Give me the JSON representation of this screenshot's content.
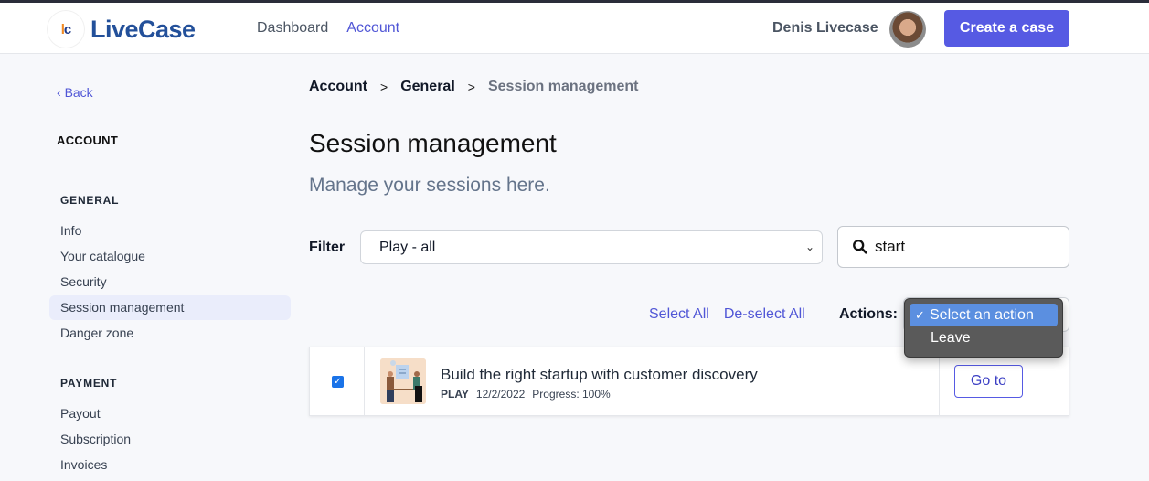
{
  "header": {
    "logo_text": "LiveCase",
    "logo_badge_l": "l",
    "logo_badge_c": "c",
    "nav": [
      {
        "label": "Dashboard",
        "active": false
      },
      {
        "label": "Account",
        "active": true
      }
    ],
    "user_name": "Denis Livecase",
    "create_button": "Create a case",
    "accent_color": "#565ae3"
  },
  "sidebar": {
    "back": "Back",
    "heading": "ACCOUNT",
    "sections": [
      {
        "title": "GENERAL",
        "items": [
          "Info",
          "Your catalogue",
          "Security",
          "Session management",
          "Danger zone"
        ]
      },
      {
        "title": "PAYMENT",
        "items": [
          "Payout",
          "Subscription",
          "Invoices"
        ]
      }
    ],
    "active_item": "Session management"
  },
  "breadcrumb": [
    "Account",
    "General",
    "Session management"
  ],
  "page": {
    "title": "Session management",
    "subtitle": "Manage your sessions here."
  },
  "filter": {
    "label": "Filter",
    "selected": "Play - all"
  },
  "search": {
    "value": "start",
    "icon": "search-icon"
  },
  "selection": {
    "select_all": "Select All",
    "deselect_all": "De-select All"
  },
  "actions": {
    "label": "Actions:",
    "options": [
      "Select an action",
      "Leave"
    ],
    "selected": "Select an action",
    "check_glyph": "✓"
  },
  "sessions": [
    {
      "title": "Build the right startup with customer discovery",
      "type": "PLAY",
      "date": "12/2/2022",
      "progress": "Progress: 100%",
      "checked": true,
      "button": "Go to"
    }
  ]
}
